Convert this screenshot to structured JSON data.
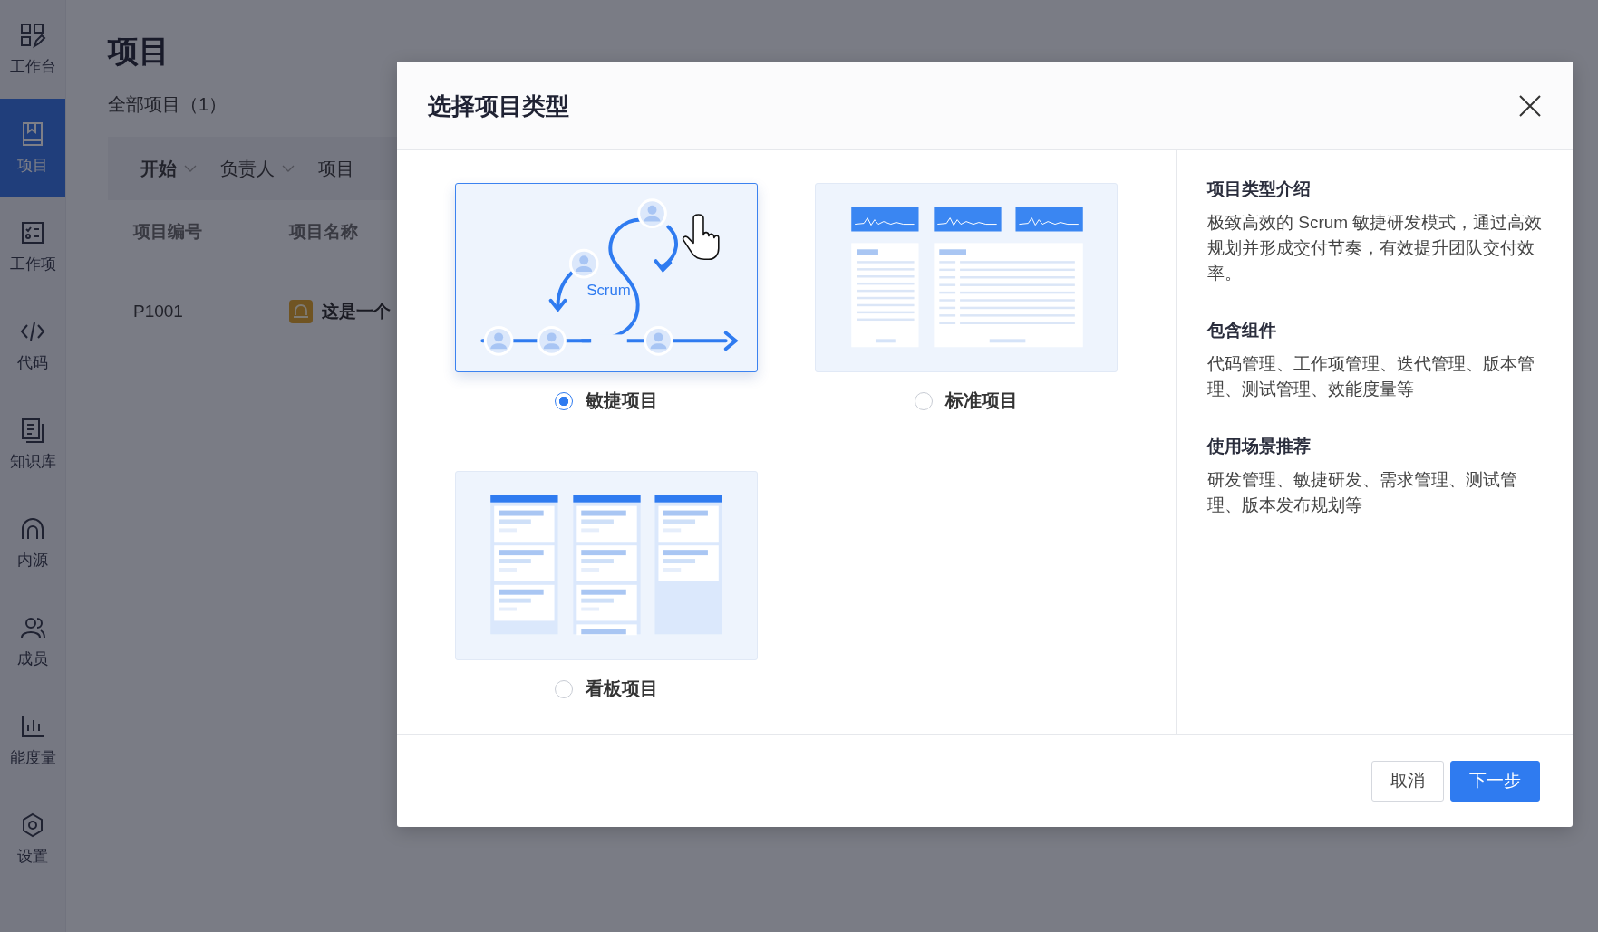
{
  "sidebar": {
    "items": [
      {
        "label": "工作台",
        "selected": false
      },
      {
        "label": "项目",
        "selected": true
      },
      {
        "label": "工作项",
        "selected": false
      },
      {
        "label": "代码",
        "selected": false
      },
      {
        "label": "知识库",
        "selected": false
      },
      {
        "label": "内源",
        "selected": false
      },
      {
        "label": "成员",
        "selected": false
      },
      {
        "label": "能度量",
        "selected": false
      },
      {
        "label": "设置",
        "selected": false
      }
    ]
  },
  "page": {
    "title": "项目",
    "subtitle": "全部项目（1）",
    "filters": [
      {
        "label": "开始",
        "selected": true,
        "dropdown": true
      },
      {
        "label": "负责人",
        "selected": false,
        "dropdown": true
      },
      {
        "label": "项目",
        "selected": false,
        "dropdown": false
      }
    ],
    "table": {
      "columns": [
        "项目编号",
        "项目名称"
      ],
      "rows": [
        {
          "number": "P1001",
          "name": "这是一个"
        }
      ]
    }
  },
  "dialog": {
    "title": "选择项目类型",
    "project_types": [
      {
        "kind": "scrum",
        "label": "敏捷项目",
        "selected": true,
        "illustration_text": "Scrum"
      },
      {
        "kind": "standard",
        "label": "标准项目",
        "selected": false
      },
      {
        "kind": "kanban",
        "label": "看板项目",
        "selected": false
      }
    ],
    "info_sections": [
      {
        "heading": "项目类型介绍",
        "text": "极致高效的 Scrum 敏捷研发模式，通过高效规划并形成交付节奏，有效提升团队交付效率。"
      },
      {
        "heading": "包含组件",
        "text": "代码管理、工作项管理、迭代管理、版本管理、测试管理、效能度量等"
      },
      {
        "heading": "使用场景推荐",
        "text": "研发管理、敏捷研发、需求管理、测试管理、版本发布规划等"
      }
    ],
    "buttons": [
      {
        "kind": "secondary",
        "label": "取消"
      },
      {
        "kind": "primary",
        "label": "下一步"
      }
    ]
  }
}
